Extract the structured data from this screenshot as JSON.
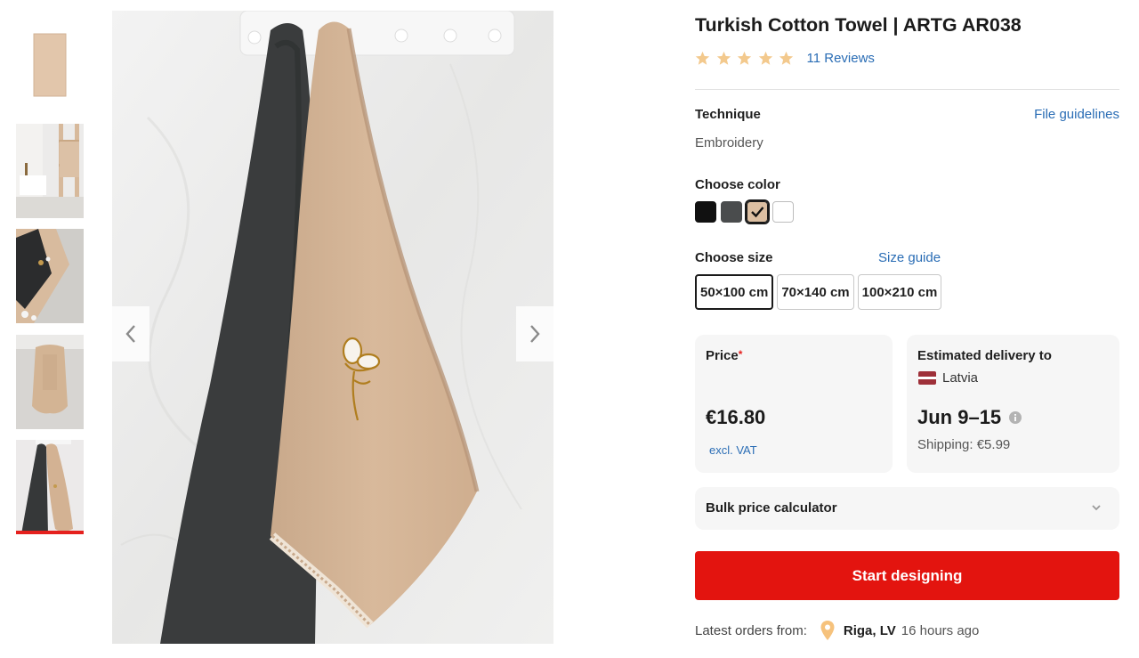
{
  "product": {
    "title": "Turkish Cotton Towel | ARTG AR038",
    "rating_stars": 5,
    "reviews_label": "11 Reviews"
  },
  "technique": {
    "label": "Technique",
    "value": "Embroidery",
    "guidelines_link": "File guidelines"
  },
  "color": {
    "label": "Choose color",
    "options": [
      {
        "name": "black",
        "hex": "#111111"
      },
      {
        "name": "dark-grey",
        "hex": "#4a4c4d"
      },
      {
        "name": "beige",
        "hex": "#dcbfa2",
        "selected": true
      },
      {
        "name": "white",
        "hex": "#ffffff"
      }
    ]
  },
  "size": {
    "label": "Choose size",
    "guide_link": "Size guide",
    "options": [
      "50×100 cm",
      "70×140 cm",
      "100×210 cm"
    ],
    "selected": "50×100 cm"
  },
  "price": {
    "label": "Price",
    "asterisk": "*",
    "amount": "€16.80",
    "vat_note": "excl. VAT"
  },
  "delivery": {
    "label": "Estimated delivery to",
    "country": "Latvia",
    "date_range": "Jun 9–15",
    "shipping": "Shipping: €5.99"
  },
  "bulk": {
    "label": "Bulk price calculator"
  },
  "cta": {
    "label": "Start designing"
  },
  "latest_orders": {
    "label": "Latest orders from:",
    "city": "Riga, LV",
    "time_ago": "16 hours ago"
  },
  "colors": {
    "accent_red": "#e3140f",
    "link_blue": "#2a6db5",
    "star": "#f3c98d",
    "card_bg": "#f6f6f6"
  }
}
